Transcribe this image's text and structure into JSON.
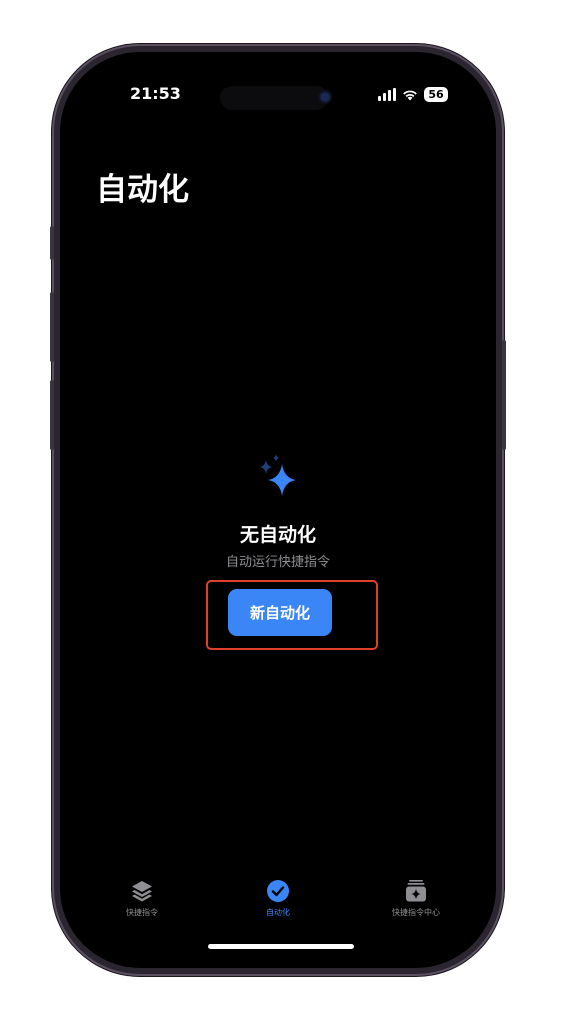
{
  "status": {
    "time": "21:53",
    "battery": "56"
  },
  "page": {
    "title": "自动化"
  },
  "empty_state": {
    "icon": "sparkles-icon",
    "title": "无自动化",
    "subtitle": "自动运行快捷指令"
  },
  "cta": {
    "label": "新自动化",
    "highlight_color": "#e0402a"
  },
  "tabbar": {
    "items": [
      {
        "label": "快捷指令",
        "icon": "layers-icon",
        "active": false
      },
      {
        "label": "自动化",
        "icon": "clock-check-icon",
        "active": true
      },
      {
        "label": "快捷指令中心",
        "icon": "gallery-icon",
        "active": false
      }
    ]
  },
  "colors": {
    "accent": "#3a86f7",
    "background": "#000000",
    "inactive": "#8e8e93"
  }
}
